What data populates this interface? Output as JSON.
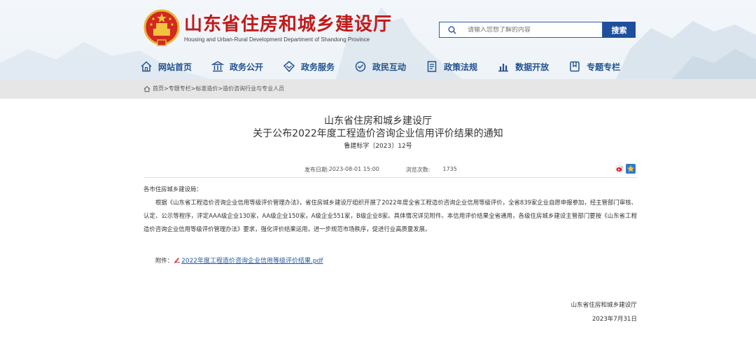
{
  "site": {
    "title": "山东省住房和城乡建设厅",
    "subtitle": "Housing and Urban-Rural Development Department of Shandong Province"
  },
  "search": {
    "placeholder": "请输入您想了解的内容",
    "button_label": "搜索"
  },
  "nav": {
    "items": [
      {
        "label": "网站首页",
        "icon": "home-icon"
      },
      {
        "label": "政务公开",
        "icon": "building-icon"
      },
      {
        "label": "政务服务",
        "icon": "diamond-service-icon"
      },
      {
        "label": "政民互动",
        "icon": "interaction-icon"
      },
      {
        "label": "政策法规",
        "icon": "document-icon"
      },
      {
        "label": "数据开放",
        "icon": "bar-chart-icon"
      },
      {
        "label": "专题专栏",
        "icon": "bookmark-icon"
      }
    ]
  },
  "breadcrumb": {
    "text": "首页>专题专栏>标准造价>造价咨询行业与专业人员"
  },
  "article": {
    "title_line1": "山东省住房和城乡建设厅",
    "title_line2": "关于公布2022年度工程造价咨询企业信用评价结果的通知",
    "doc_number": "鲁建标字〔2023〕12号",
    "publish_label": "发布日期:",
    "publish_date": "2023-08-01 15:00",
    "views_label": "浏览次数:",
    "views": "1735",
    "salutation": "各市住房城乡建设局：",
    "paragraph": "根据《山东省工程造价咨询企业信用等级评价管理办法》，省住房城乡建设厅组织开展了2022年度全省工程造价咨询企业信用等级评价，全省839家企业自愿申报参加，经主管部门审核、认定、公示等程序，评定AAA级企业130家，AA级企业150家，A级企业551家，B级企业8家。具体情况详见附件。本信用评价结果全省通用，各级住房城乡建设主管部门要按《山东省工程造价咨询企业信用等级评价管理办法》要求，强化评价结果运用，进一步规范市场秩序，促进行业高质量发展。",
    "attachment_label": "附件：",
    "attachment_link": "2022年度工程造价咨询企业信用等级评价结果.pdf",
    "signature_org": "山东省住房和城乡建设厅",
    "signature_date": "2023年7月31日"
  },
  "colors": {
    "brand_red": "#c11a1a",
    "nav_blue": "#22528f",
    "search_blue": "#1e4f9c",
    "link_blue": "#2457a5"
  }
}
